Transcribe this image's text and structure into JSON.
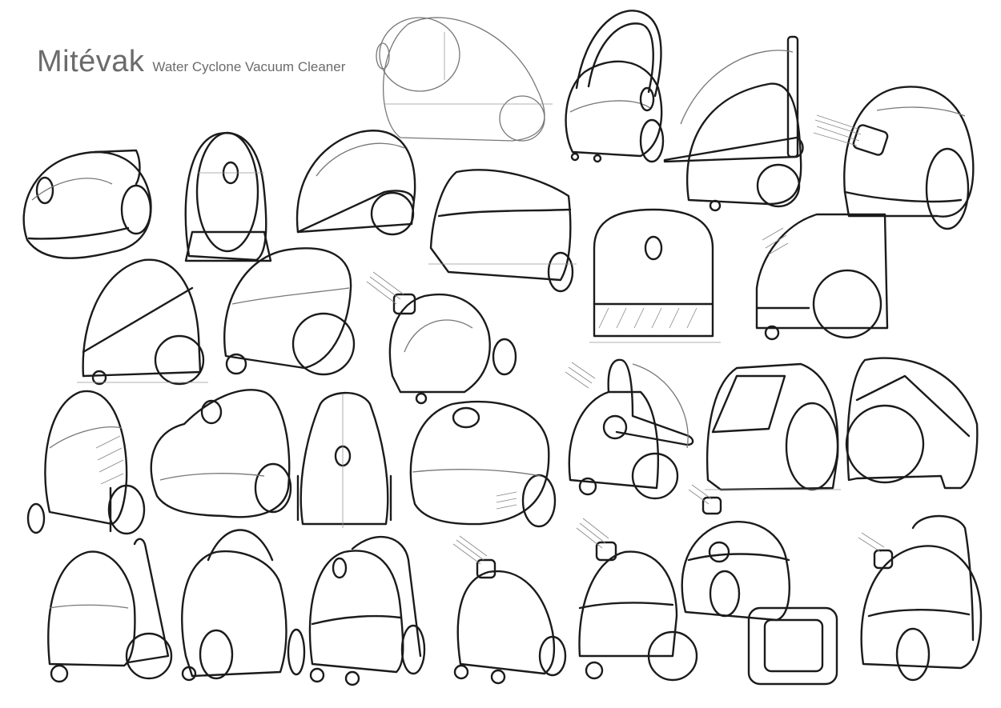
{
  "sheet": {
    "brand": "Mitévak",
    "subtitle": "Water Cyclone Vacuum Cleaner"
  }
}
